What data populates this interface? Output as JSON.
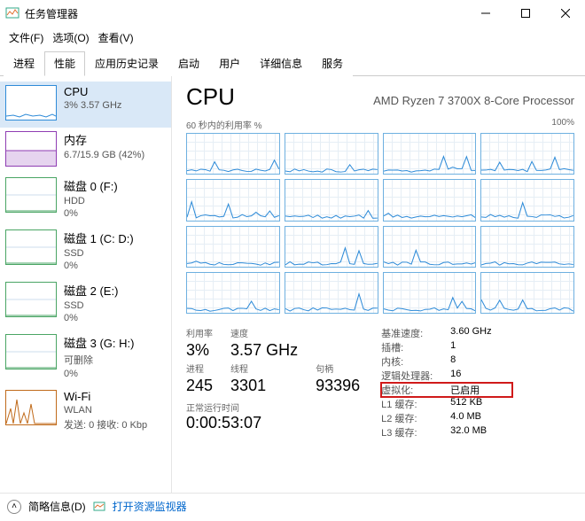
{
  "window": {
    "title": "任务管理器"
  },
  "menu": {
    "file": "文件(F)",
    "options": "选项(O)",
    "view": "查看(V)"
  },
  "tabs": [
    "进程",
    "性能",
    "应用历史记录",
    "启动",
    "用户",
    "详细信息",
    "服务"
  ],
  "active_tab": 1,
  "sidebar": {
    "items": [
      {
        "title": "CPU",
        "sub": "3% 3.57 GHz",
        "color": "#2e8bd8"
      },
      {
        "title": "内存",
        "sub": "6.7/15.9 GB (42%)",
        "color": "#8f3db3"
      },
      {
        "title": "磁盘 0 (F:)",
        "sub1": "HDD",
        "sub2": "0%",
        "color": "#4aa564"
      },
      {
        "title": "磁盘 1 (C: D:)",
        "sub1": "SSD",
        "sub2": "0%",
        "color": "#4aa564"
      },
      {
        "title": "磁盘 2 (E:)",
        "sub1": "SSD",
        "sub2": "0%",
        "color": "#4aa564"
      },
      {
        "title": "磁盘 3 (G: H:)",
        "sub1": "可删除",
        "sub2": "0%",
        "color": "#4aa564"
      },
      {
        "title": "Wi-Fi",
        "sub1": "WLAN",
        "sub2": "发送: 0 接收: 0 Kbp",
        "color": "#c06a1a"
      }
    ]
  },
  "cpu": {
    "heading": "CPU",
    "name": "AMD Ryzen 7 3700X 8-Core Processor",
    "graph_label_left": "60 秒内的利用率 %",
    "graph_label_right": "100%",
    "stats": {
      "util_label": "利用率",
      "util": "3%",
      "speed_label": "速度",
      "speed": "3.57 GHz",
      "proc_label": "进程",
      "proc": "245",
      "threads_label": "线程",
      "threads": "3301",
      "handles_label": "句柄",
      "handles": "93396",
      "uptime_label": "正常运行时间",
      "uptime": "0:00:53:07"
    },
    "info": {
      "base_k": "基准速度:",
      "base_v": "3.60 GHz",
      "sockets_k": "插槽:",
      "sockets_v": "1",
      "cores_k": "内核:",
      "cores_v": "8",
      "lp_k": "逻辑处理器:",
      "lp_v": "16",
      "virt_k": "虚拟化:",
      "virt_v": "已启用",
      "l1_k": "L1 缓存:",
      "l1_v": "512 KB",
      "l2_k": "L2 缓存:",
      "l2_v": "4.0 MB",
      "l3_k": "L3 缓存:",
      "l3_v": "32.0 MB"
    }
  },
  "footer": {
    "brief": "简略信息(D)",
    "resmon": "打开资源监视器"
  },
  "chart_data": {
    "type": "line",
    "title": "60 秒内的利用率 %",
    "ylim": [
      0,
      100
    ],
    "series_count": 16,
    "note": "per-logical-processor sparklines; values are low (roughly 0–10%) with occasional spikes up to ~40–60% on some cores"
  }
}
